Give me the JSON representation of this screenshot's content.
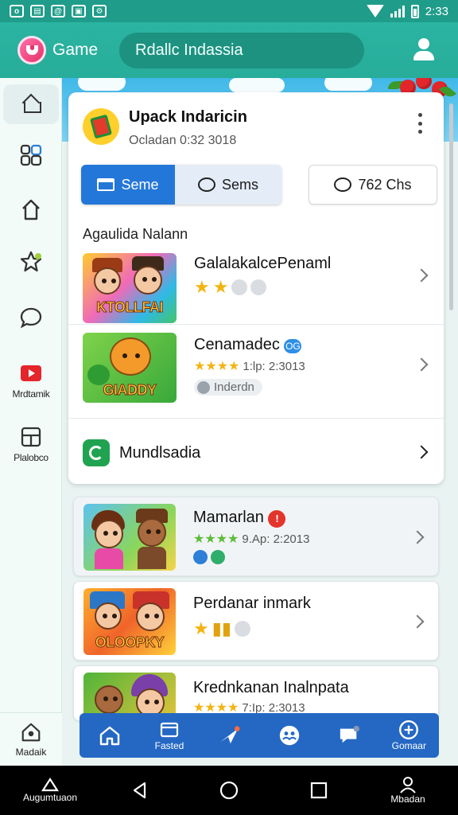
{
  "status_bar": {
    "time": "2:33"
  },
  "app": {
    "name": "Game",
    "search_text": "Rdallc Indassia"
  },
  "rail": {
    "items": [
      {
        "icon": "home-icon",
        "label": ""
      },
      {
        "icon": "apps-icon",
        "label": ""
      },
      {
        "icon": "upload-icon",
        "label": ""
      },
      {
        "icon": "star-icon",
        "label": ""
      },
      {
        "icon": "chat-icon",
        "label": ""
      },
      {
        "icon": "youtube-icon",
        "label": "Mrdtamik"
      },
      {
        "icon": "tablet-icon",
        "label": "Plalobco"
      }
    ],
    "bottom_label": "Madaik"
  },
  "card": {
    "title": "Upack Indaricin",
    "subtitle": "Ocladan 0:32 3018",
    "seg_active": "Seme",
    "seg_inactive": "Sems",
    "chats_label": "762 Chs",
    "section_label": "Agaulida Nalann",
    "rows": [
      {
        "title": "GalalakalcePenaml",
        "meta": "",
        "stars": 2
      },
      {
        "title": "Cenamadec",
        "badge": "OG",
        "meta": "1:lp: 2:3013",
        "tag": "Inderdn"
      },
      {
        "title": "Mundlsadia"
      }
    ]
  },
  "list": [
    {
      "title": "Mamarlan",
      "meta": "9.Ap: 2:2013",
      "badge": "!"
    },
    {
      "title": "Perdanar inmark",
      "meta": ""
    },
    {
      "title": "Krednkanan Inalnpata",
      "meta": "7:Ip: 2:3013"
    }
  ],
  "thumb_text": [
    "KTOLLFAI",
    "GIADDY",
    "",
    "OLOOPKY"
  ],
  "tabbar": [
    {
      "icon": "home-tab-icon",
      "label": ""
    },
    {
      "icon": "folder-tab-icon",
      "label": "Fasted"
    },
    {
      "icon": "plane-tab-icon",
      "label": ""
    },
    {
      "icon": "people-tab-icon",
      "label": ""
    },
    {
      "icon": "chat-tab-icon",
      "label": ""
    },
    {
      "icon": "game-tab-icon",
      "label": "Gomaar"
    }
  ],
  "navbar": {
    "left_label": "Augumtuaon",
    "right_label": "Mbadan"
  },
  "colors": {
    "appbar": "#2bb4a2",
    "accent": "#2377d8",
    "tabbar": "#2468c4"
  }
}
